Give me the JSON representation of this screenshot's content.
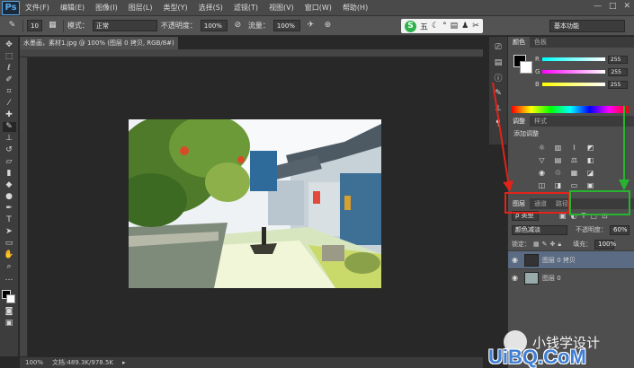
{
  "app": {
    "logo": "Ps",
    "menu": [
      "文件(F)",
      "编辑(E)",
      "图像(I)",
      "图层(L)",
      "类型(Y)",
      "选择(S)",
      "滤镜(T)",
      "视图(V)",
      "窗口(W)",
      "帮助(H)"
    ],
    "window_controls": [
      "—",
      "□",
      "✕"
    ]
  },
  "options": {
    "brush_size": "10",
    "mode_label": "模式：",
    "mode_value": "正常",
    "opacity_label": "不透明度：",
    "opacity_value": "100%",
    "flow_label": "流量：",
    "flow_value": "100%",
    "workspace": "基本功能",
    "ime_text": "五"
  },
  "document": {
    "tab_title": "水墨画，素材1.jpg @ 100% (图层 0 拷贝, RGB/8#)",
    "zoom": "100%",
    "doc_info": "文档:489.3K/978.5K"
  },
  "color_panel": {
    "tabs": [
      "颜色",
      "色板"
    ],
    "r_label": "R",
    "r_value": "255",
    "g_label": "G",
    "g_value": "255",
    "b_label": "B",
    "b_value": "255"
  },
  "adjust_panel": {
    "tabs": [
      "调整",
      "样式"
    ],
    "add_label": "添加调整"
  },
  "layers_panel": {
    "tabs": [
      "图层",
      "通道",
      "路径"
    ],
    "kind_label": "ρ 类型",
    "blend_mode": "颜色减淡",
    "opacity_label": "不透明度：",
    "opacity_value": "60%",
    "lock_label": "锁定：",
    "fill_label": "填充：",
    "fill_value": "100%",
    "layers": [
      {
        "name": "图层 0 拷贝",
        "selected": true
      },
      {
        "name": "图层 0",
        "selected": false
      }
    ]
  },
  "watermark": {
    "wechat_name": "小钱学设计",
    "site": "UiBQ.CoM"
  },
  "colors": {
    "red_annotation": "#e2231a",
    "green_annotation": "#27b530",
    "selected_layer": "#5b6b84"
  }
}
